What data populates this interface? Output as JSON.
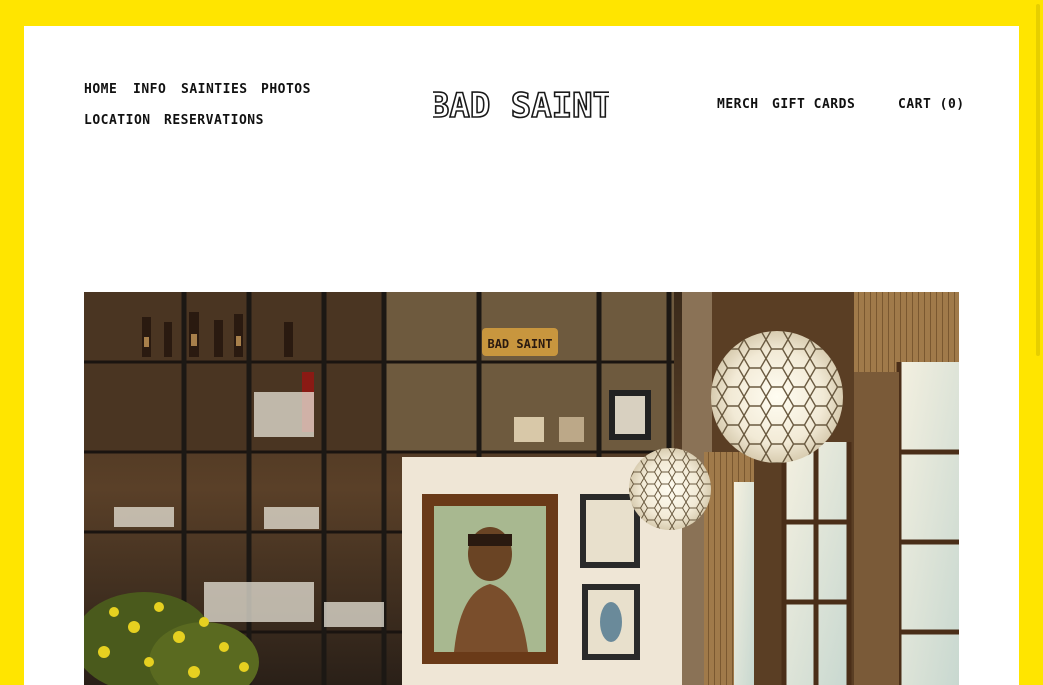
{
  "nav_left": {
    "home": "HOME",
    "info": "INFO",
    "sainties": "SAINTIES",
    "photos": "PHOTOS",
    "location": "LOCATION",
    "reservations": "RESERVATIONS"
  },
  "logo": {
    "text": "BAD SAINT"
  },
  "nav_right": {
    "merch": "MERCH",
    "gift_cards": "GIFT CARDS",
    "cart": "CART (0)"
  },
  "hero": {
    "sign_text": "BAD SAINT"
  },
  "colors": {
    "frame_yellow": "#ffe500",
    "text": "#111111",
    "background": "#ffffff"
  }
}
